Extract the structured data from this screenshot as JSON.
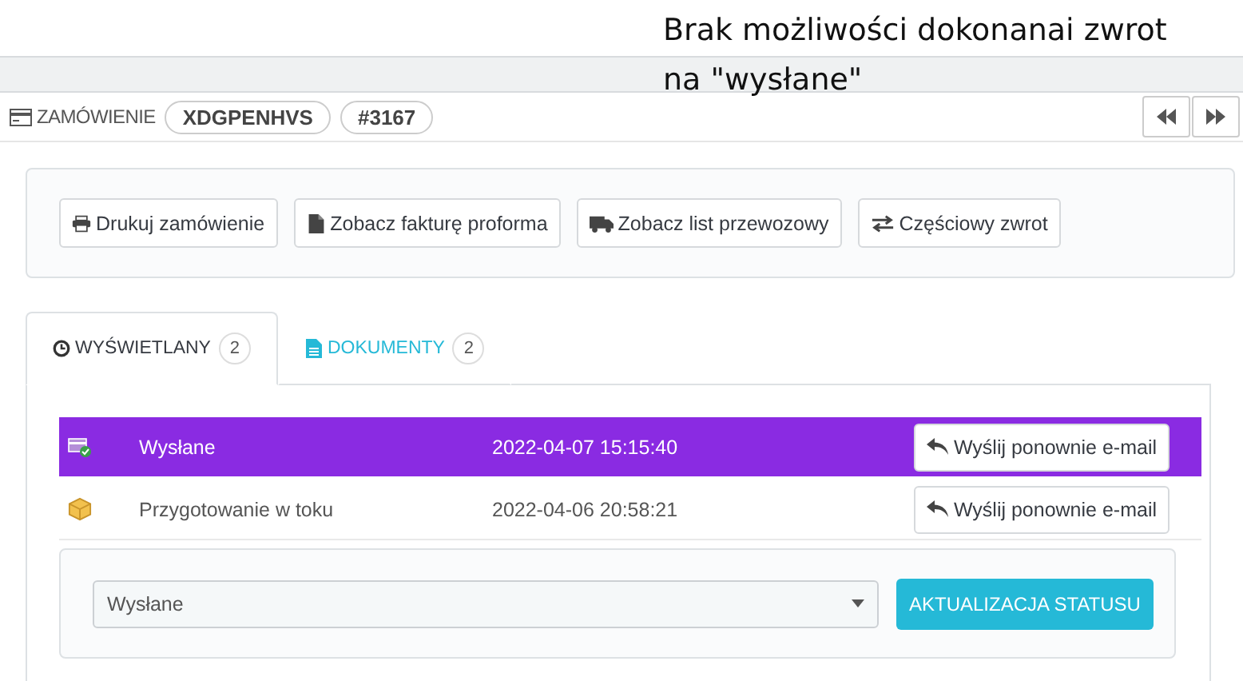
{
  "annotation": [
    "Brak możliwości dokonanai zwrot",
    "na \"wysłane\""
  ],
  "header": {
    "label": "ZAMÓWIENIE",
    "badges": [
      "XDGPENHVS",
      "#3167"
    ]
  },
  "nav_buttons": [
    {
      "kind": "prev"
    },
    {
      "kind": "next"
    }
  ],
  "actions": [
    {
      "kind": "print",
      "label": "Drukuj zamówienie"
    },
    {
      "kind": "file",
      "label": "Zobacz fakturę proforma"
    },
    {
      "kind": "truck",
      "label": "Zobacz list przewozowy"
    },
    {
      "kind": "exchange",
      "label": "Częściowy zwrot"
    }
  ],
  "tabs": [
    {
      "kind": "clock",
      "label": "WYŚWIETLANY",
      "count": "2",
      "selected": true
    },
    {
      "kind": "file",
      "label": "DOKUMENTY",
      "count": "2",
      "selected": false
    }
  ],
  "history": [
    {
      "kind": "shipped",
      "status": "Wysłane",
      "date": "2022-04-07 15:15:40",
      "button": "Wyślij ponownie e-mail",
      "color": "#8a2be2"
    },
    {
      "kind": "preparing",
      "status": "Przygotowanie w toku",
      "date": "2022-04-06 20:58:21",
      "button": "Wyślij ponownie e-mail"
    }
  ],
  "status_select": {
    "value": "Wysłane"
  },
  "update_button": "AKTUALIZACJA STATUSU"
}
